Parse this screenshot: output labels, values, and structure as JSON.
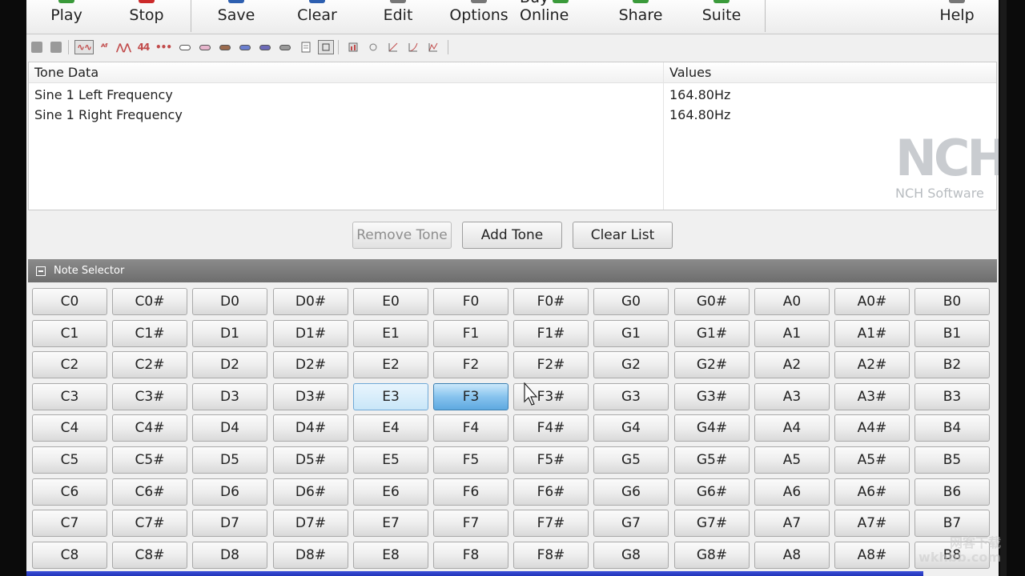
{
  "toolbar": {
    "buttons": [
      {
        "label": "Play",
        "icon": "play-icon",
        "color": "#3a9a3a"
      },
      {
        "label": "Stop",
        "icon": "stop-icon",
        "color": "#cc2a2a"
      },
      {
        "label": "Save",
        "icon": "save-icon",
        "color": "#2d5fb0"
      },
      {
        "label": "Clear",
        "icon": "clear-icon",
        "color": "#2d5fb0"
      },
      {
        "label": "Edit",
        "icon": "edit-icon",
        "color": "#777777"
      },
      {
        "label": "Options",
        "icon": "options-icon",
        "color": "#777777"
      },
      {
        "label": "Buy Online",
        "icon": "cart-icon",
        "color": "#3a9a3a"
      },
      {
        "label": "Share",
        "icon": "share-icon",
        "color": "#3a9a3a"
      },
      {
        "label": "Suite",
        "icon": "suite-icon",
        "color": "#3a9a3a"
      },
      {
        "label": "Help",
        "icon": "help-icon",
        "color": "#777777"
      }
    ]
  },
  "table": {
    "headers": [
      "Tone Data",
      "Values"
    ],
    "rows": [
      {
        "label": "Sine 1 Left Frequency",
        "value": "164.80Hz"
      },
      {
        "label": "Sine 1 Right Frequency",
        "value": "164.80Hz"
      }
    ]
  },
  "logo": {
    "mark": "NCH",
    "text": "NCH Software"
  },
  "actions": {
    "remove": "Remove Tone",
    "add": "Add Tone",
    "clear": "Clear List"
  },
  "note_selector": {
    "title": "Note Selector",
    "selected": "F3",
    "hover": "E3",
    "rows": [
      [
        "C0",
        "C0#",
        "D0",
        "D0#",
        "E0",
        "F0",
        "F0#",
        "G0",
        "G0#",
        "A0",
        "A0#",
        "B0"
      ],
      [
        "C1",
        "C1#",
        "D1",
        "D1#",
        "E1",
        "F1",
        "F1#",
        "G1",
        "G1#",
        "A1",
        "A1#",
        "B1"
      ],
      [
        "C2",
        "C2#",
        "D2",
        "D2#",
        "E2",
        "F2",
        "F2#",
        "G2",
        "G2#",
        "A2",
        "A2#",
        "B2"
      ],
      [
        "C3",
        "C3#",
        "D3",
        "D3#",
        "E3",
        "F3",
        "F3#",
        "G3",
        "G3#",
        "A3",
        "A3#",
        "B3"
      ],
      [
        "C4",
        "C4#",
        "D4",
        "D4#",
        "E4",
        "F4",
        "F4#",
        "G4",
        "G4#",
        "A4",
        "A4#",
        "B4"
      ],
      [
        "C5",
        "C5#",
        "D5",
        "D5#",
        "E5",
        "F5",
        "F5#",
        "G5",
        "G5#",
        "A5",
        "A5#",
        "B5"
      ],
      [
        "C6",
        "C6#",
        "D6",
        "D6#",
        "E6",
        "F6",
        "F6#",
        "G6",
        "G6#",
        "A6",
        "A6#",
        "B6"
      ],
      [
        "C7",
        "C7#",
        "D7",
        "D7#",
        "E7",
        "F7",
        "F7#",
        "G7",
        "G7#",
        "A7",
        "A7#",
        "B7"
      ],
      [
        "C8",
        "C8#",
        "D8",
        "D8#",
        "E8",
        "F8",
        "F8#",
        "G8",
        "G8#",
        "A8",
        "A8#",
        "B8"
      ]
    ]
  },
  "watermark": {
    "line1": "网客下载",
    "line2": "wkhbb.com"
  }
}
